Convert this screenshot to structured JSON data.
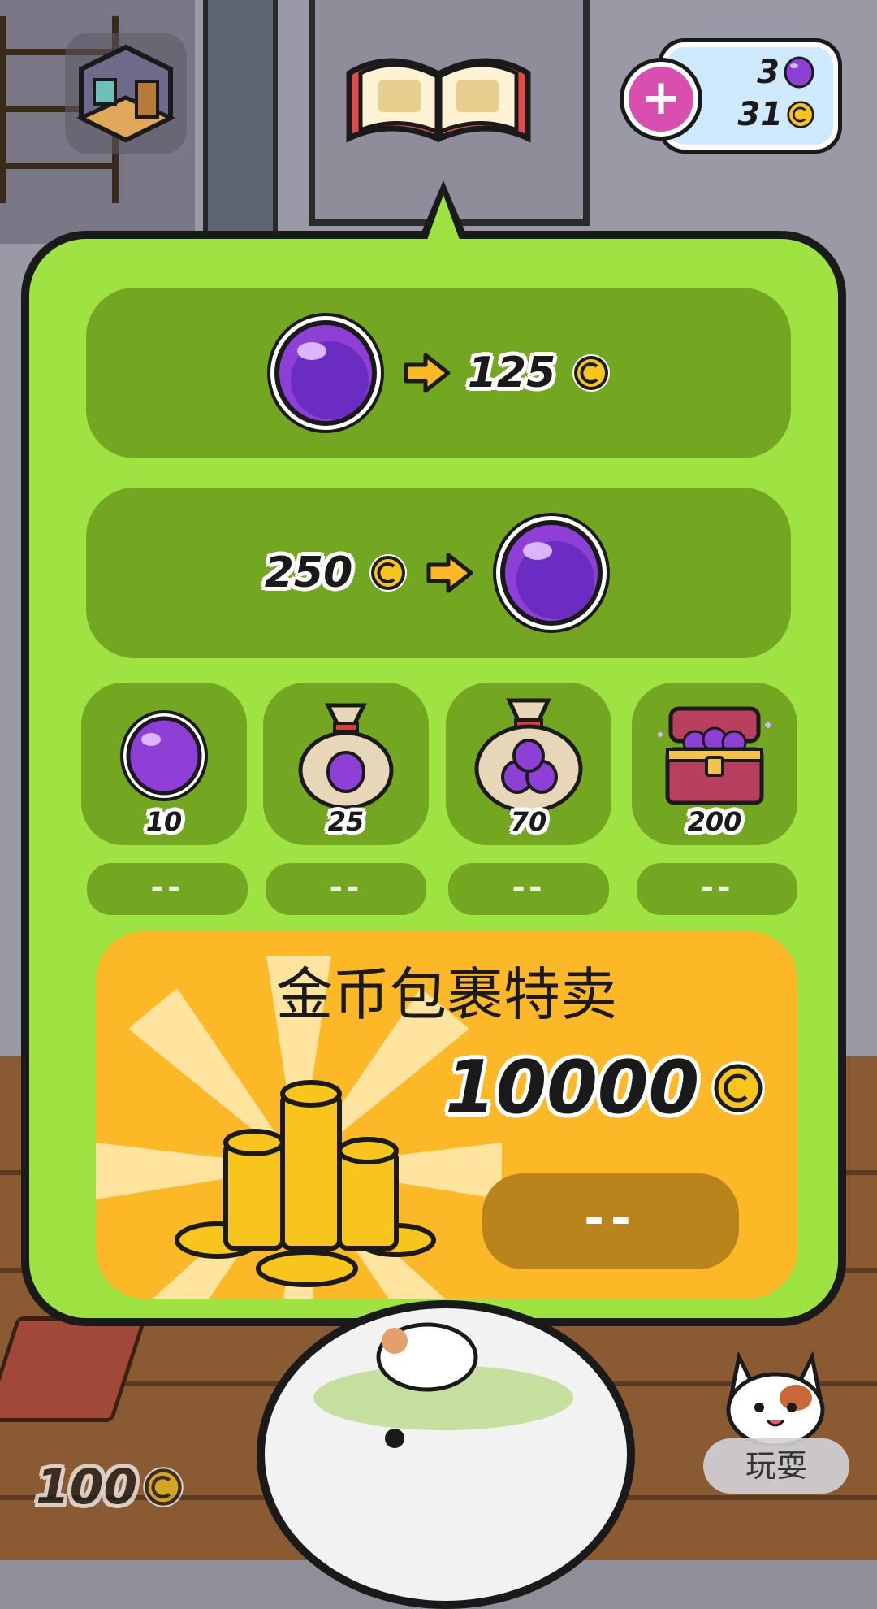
{
  "hud": {
    "add_button_label": "+",
    "gem_balance": "3",
    "coin_balance": "31"
  },
  "exchange": {
    "gem_to_coin": {
      "gem_amount": "",
      "coin_amount": "125"
    },
    "coin_to_gem": {
      "coin_amount": "250"
    }
  },
  "gem_packs": [
    {
      "count": "10",
      "price": "--",
      "icon": "single-gem-icon"
    },
    {
      "count": "25",
      "price": "--",
      "icon": "gem-pouch-small-icon"
    },
    {
      "count": "70",
      "price": "--",
      "icon": "gem-pouch-large-icon"
    },
    {
      "count": "200",
      "price": "--",
      "icon": "gem-chest-icon"
    }
  ],
  "special_offer": {
    "title": "金币包裹特卖",
    "amount": "10000",
    "button_label": "--"
  },
  "footer": {
    "coin_counter": "100",
    "play_button_label": "玩耍"
  },
  "colors": {
    "popup_bg": "#9ee342",
    "offer_bg": "#73a722",
    "special_bg": "#fdb827",
    "special_button": "#b8841b",
    "gem": "#8e3fd6",
    "coin": "#f7c51b"
  }
}
